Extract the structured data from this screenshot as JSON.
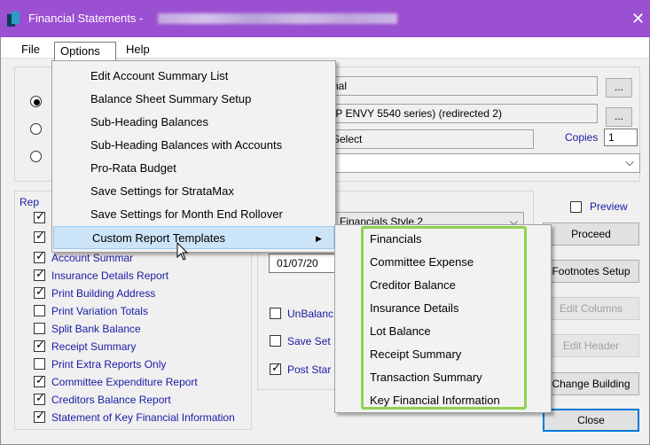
{
  "window": {
    "title": "Financial Statements - ",
    "title_redacted": "",
    "close_label": "✕"
  },
  "menubar": {
    "file": "File",
    "options": "Options",
    "help": "Help"
  },
  "options_menu": [
    {
      "label": "Edit Account Summary List"
    },
    {
      "label": "Balance Sheet Summary Setup"
    },
    {
      "label": "Sub-Heading Balances"
    },
    {
      "label": "Sub-Heading Balances with Accounts"
    },
    {
      "label": "Pro-Rata Budget"
    },
    {
      "label": "Save Settings for StrataMax"
    },
    {
      "label": "Save Settings for Month End Rollover"
    },
    {
      "label": "Custom Report Templates",
      "arrow": "▶"
    }
  ],
  "submenu": [
    {
      "label": "Financials"
    },
    {
      "label": "Committee Expense"
    },
    {
      "label": "Creditor Balance"
    },
    {
      "label": "Insurance Details"
    },
    {
      "label": "Lot Balance"
    },
    {
      "label": "Receipt Summary"
    },
    {
      "label": "Transaction Summary"
    },
    {
      "label": "Key Financial Information"
    }
  ],
  "output": {
    "field1": "nal",
    "field2": "IP ENVY 5540 series) (redirected 2)",
    "field3": "Select",
    "copies_label": "Copies",
    "copies_value": "1",
    "browse": "..."
  },
  "reports": {
    "group_label": "Rep",
    "items": [
      {
        "label": "Account Summar",
        "checked": true
      },
      {
        "label": "Insurance Details Report",
        "checked": true
      },
      {
        "label": "Print Building Address",
        "checked": true
      },
      {
        "label": "Print Variation Totals",
        "checked": false
      },
      {
        "label": "Split Bank Balance",
        "checked": false
      },
      {
        "label": "Receipt Summary",
        "checked": true
      },
      {
        "label": "Print Extra Reports Only",
        "checked": false
      },
      {
        "label": "Committee Expenditure Report",
        "checked": true
      },
      {
        "label": "Creditors Balance Report",
        "checked": true
      },
      {
        "label": "Statement of Key Financial Information",
        "checked": true
      }
    ]
  },
  "middle": {
    "style_value": "Financials Style 2",
    "date_value": "01/07/20",
    "unbalanced": "UnBalanc",
    "save_set": "Save Set",
    "post_star": "Post Star"
  },
  "right": {
    "preview": "Preview",
    "proceed": "Proceed",
    "footnotes": "Footnotes Setup",
    "edit_columns": "Edit Columns",
    "edit_header": "Edit Header",
    "change_building": "Change Building",
    "close": "Close"
  }
}
